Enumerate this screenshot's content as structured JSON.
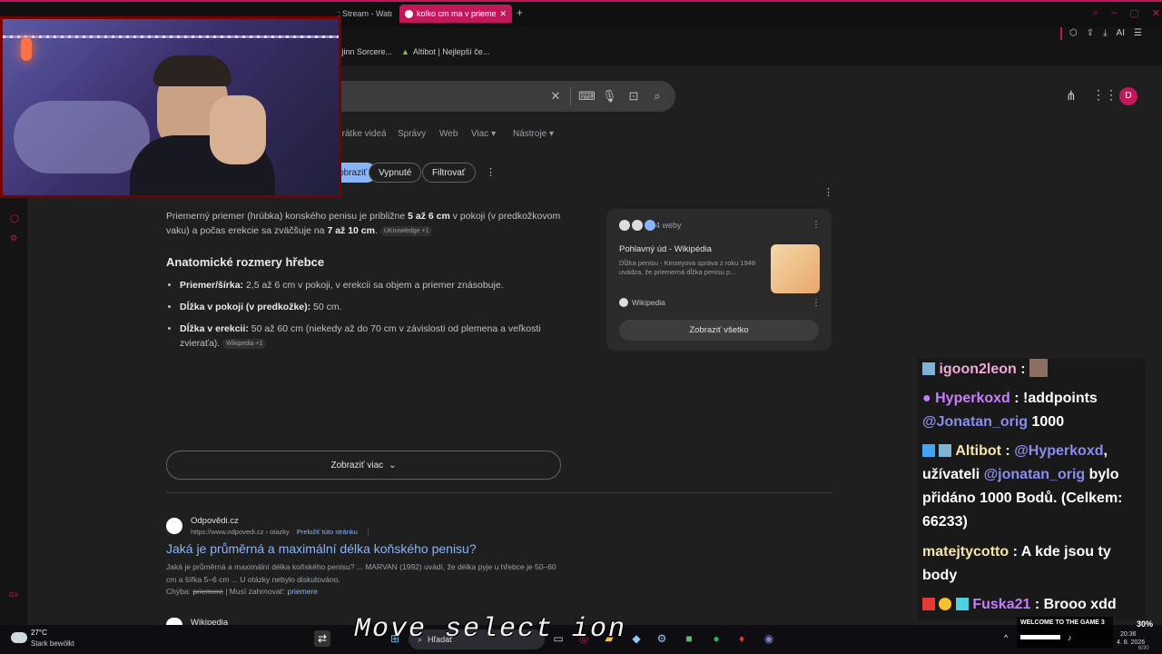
{
  "browser": {
    "tabs": [
      {
        "label": ": Stream - Watc",
        "active": false
      },
      {
        "label": "kolko cm ma v priemer",
        "active": true
      }
    ],
    "new_tab": "+",
    "toolbar_ai": "AI",
    "bookmarks": [
      "Djinn Sorcere...",
      "Altibot | Nejlepší če..."
    ]
  },
  "search": {
    "account_initial": "D",
    "nav_tabs": [
      "Krátke videá",
      "Správy",
      "Web",
      "Viac",
      "Nástroje"
    ],
    "chips": [
      "Zobraziť",
      "Vypnuté",
      "Filtrovať"
    ]
  },
  "ai_overview": {
    "intro_a": "Priemerný priemer (hrúbka) konského penisu je približne ",
    "intro_b1": "5 až 6 cm",
    "intro_c": " v pokoji (v predkožkovom vaku) a počas erekcie sa zväčšuje na ",
    "intro_b2": "7 až 10 cm",
    "intro_d": ".",
    "intro_source": "UKnowledge +1",
    "heading": "Anatomické rozmery hřebce",
    "items": [
      {
        "label": "Priemer/šírka:",
        "text": " 2,5 až 6 cm v pokoji, v erekcii sa objem a priemer znásobuje."
      },
      {
        "label": "Dĺžka v pokoji (v predkožke):",
        "text": " 50 cm."
      },
      {
        "label": "Dĺžka v erekcii:",
        "text": " 50 až 60 cm (niekedy až do 70 cm v závislosti od plemena a veľkosti zvieraťa).",
        "source": "Wikipedia +1"
      }
    ],
    "show_more": "Zobraziť viac"
  },
  "source_card": {
    "count": "4 weby",
    "title": "Pohlavný úd - Wikipédia",
    "snippet": "Dĺžka penisu - Kinseyova správa z roku 1948 uvádza, že priemerná dĺžka penisu p...",
    "site": "Wikipedia",
    "show_all": "Zobraziť všetko"
  },
  "result": {
    "site": "Odpovědi.cz",
    "url": "https://www.odpovedi.cz › otazky",
    "translate": "Preložiť túto stránku",
    "title": "Jaká je průměrná a maximální délka koňského penisu?",
    "snippet_1": "Jaká je průměrná a maximální délka koňského penisu? ... MARVAN (1992) uvádí, že délka pyje u hřebce je 50–60 cm a šířka 5–6 cm ... U otázky nebylo diskutováno.",
    "missing_label": "Chýba:",
    "missing_word": "priemere",
    "must_include": "| Musí zahrnovať:",
    "must_word": "priemere",
    "next_site": "Wikipedia"
  },
  "chat": [
    {
      "user": "igoon2leon",
      "color": "#f0a8d8",
      "text": ":"
    },
    {
      "user": "Hyperkoxd",
      "color": "#c77dff",
      "text": ": !addpoints",
      "mention": "@Jonatan_orig",
      "tail": " 1000"
    },
    {
      "user": "Altibot",
      "color": "#f5e6a8",
      "text": ":",
      "mention": "@Hyperkoxd",
      "tail": ", užívateli ",
      "mention2": "@jonatan_orig",
      "tail2": " bylo přidáno 1000 Bodů. (Celkem: 66233)"
    },
    {
      "user": "matejtycotto",
      "color": "#f5e6a8",
      "text": ": A kde jsou ty body"
    },
    {
      "user": "Fuska21",
      "color": "#c77dff",
      "text": ": Brooo xdd"
    }
  ],
  "overlay": {
    "subtitle": "Move select ion",
    "banner": "WELCOME TO THE GAME 3"
  },
  "taskbar": {
    "weather_temp": "27°C",
    "weather_desc": "Stark bewölkt",
    "search": "Hľadať",
    "battery": "30%",
    "time": "20:36",
    "date": "4. 8. 2026",
    "page": "6/30",
    "tray_chevron": "^"
  },
  "colors": {
    "accent": "#c2185b",
    "link": "#8ab4f8",
    "page_bg": "#1f1f1f"
  }
}
